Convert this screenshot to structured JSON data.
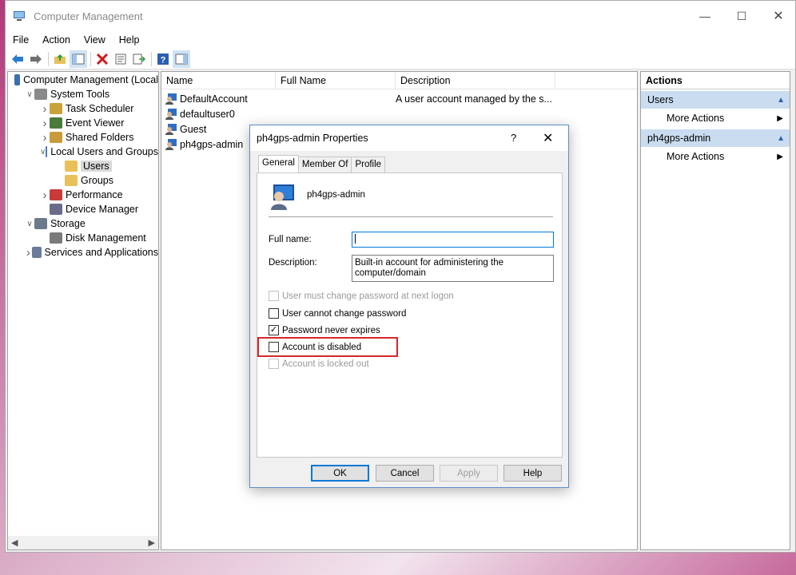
{
  "window": {
    "title": "Computer Management"
  },
  "menu": [
    "File",
    "Action",
    "View",
    "Help"
  ],
  "tree": [
    {
      "label": "Computer Management (Local",
      "indent": 0,
      "exp": "",
      "icon": "computer"
    },
    {
      "label": "System Tools",
      "indent": 1,
      "exp": "v",
      "icon": "tools"
    },
    {
      "label": "Task Scheduler",
      "indent": 2,
      "exp": ">",
      "icon": "clock"
    },
    {
      "label": "Event Viewer",
      "indent": 2,
      "exp": ">",
      "icon": "event"
    },
    {
      "label": "Shared Folders",
      "indent": 2,
      "exp": ">",
      "icon": "share"
    },
    {
      "label": "Local Users and Groups",
      "indent": 2,
      "exp": "v",
      "icon": "users"
    },
    {
      "label": "Users",
      "indent": 3,
      "exp": "",
      "icon": "folder",
      "selected": true
    },
    {
      "label": "Groups",
      "indent": 3,
      "exp": "",
      "icon": "folder"
    },
    {
      "label": "Performance",
      "indent": 2,
      "exp": ">",
      "icon": "perf"
    },
    {
      "label": "Device Manager",
      "indent": 2,
      "exp": "",
      "icon": "device"
    },
    {
      "label": "Storage",
      "indent": 1,
      "exp": "v",
      "icon": "storage"
    },
    {
      "label": "Disk Management",
      "indent": 2,
      "exp": "",
      "icon": "disk"
    },
    {
      "label": "Services and Applications",
      "indent": 1,
      "exp": ">",
      "icon": "services"
    }
  ],
  "list": {
    "columns": [
      "Name",
      "Full Name",
      "Description"
    ],
    "rows": [
      {
        "name": "DefaultAccount",
        "full": "",
        "desc": "A user account managed by the s..."
      },
      {
        "name": "defaultuser0",
        "full": "",
        "desc": ""
      },
      {
        "name": "Guest",
        "full": "",
        "desc": ""
      },
      {
        "name": "ph4gps-admin",
        "full": "",
        "desc": ""
      }
    ]
  },
  "actions": {
    "header": "Actions",
    "sections": [
      {
        "title": "Users",
        "items": [
          "More Actions"
        ]
      },
      {
        "title": "ph4gps-admin",
        "items": [
          "More Actions"
        ]
      }
    ]
  },
  "dialog": {
    "title": "ph4gps-admin Properties",
    "help": "?",
    "tabs": [
      "General",
      "Member Of",
      "Profile"
    ],
    "username": "ph4gps-admin",
    "fullname_label": "Full name:",
    "fullname_value": "",
    "description_label": "Description:",
    "description_value": "Built-in account for administering the computer/domain",
    "checkboxes": [
      {
        "label": "User must change password at next logon",
        "checked": false,
        "disabled": true
      },
      {
        "label": "User cannot change password",
        "checked": false,
        "disabled": false
      },
      {
        "label": "Password never expires",
        "checked": true,
        "disabled": false
      },
      {
        "label": "Account is disabled",
        "checked": false,
        "disabled": false
      },
      {
        "label": "Account is locked out",
        "checked": false,
        "disabled": true
      }
    ],
    "buttons": {
      "ok": "OK",
      "cancel": "Cancel",
      "apply": "Apply",
      "help": "Help"
    }
  },
  "colors": {
    "accent": "#0078d7",
    "highlight": "#d6262a",
    "action_section": "#c9dcf0"
  }
}
